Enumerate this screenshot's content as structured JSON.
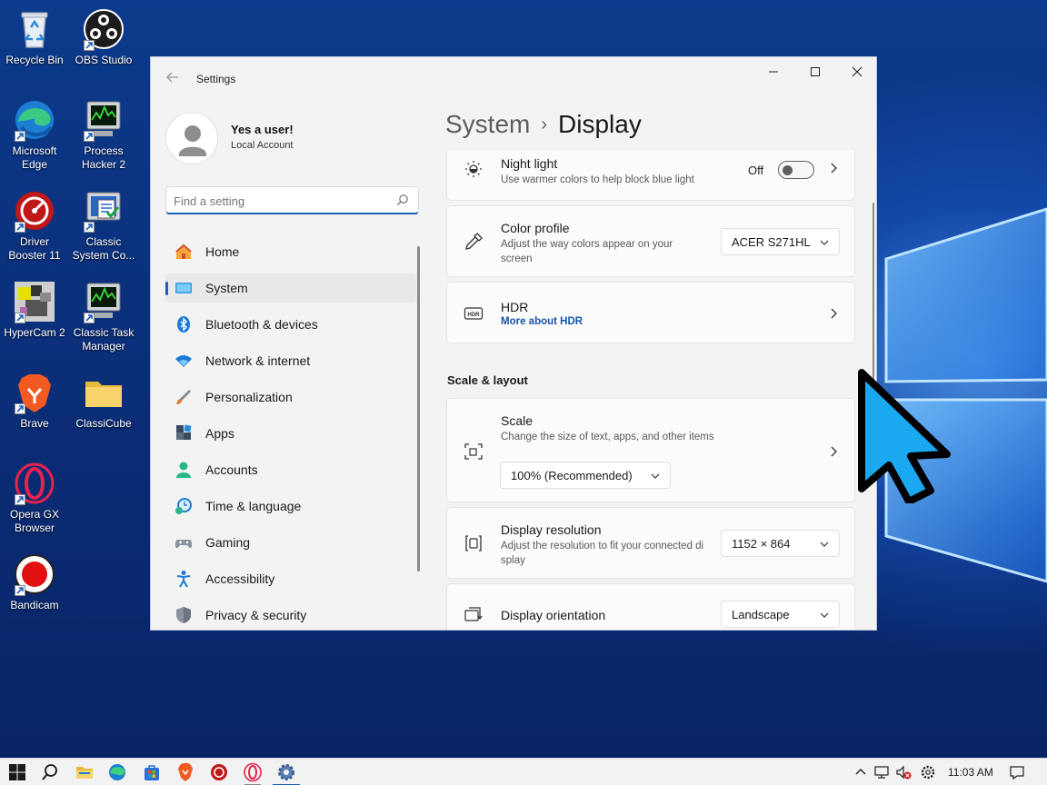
{
  "desktop": {
    "icons": [
      {
        "label": "Recycle Bin"
      },
      {
        "label": "OBS Studio"
      },
      {
        "label": "Microsoft Edge"
      },
      {
        "label": "Process Hacker 2"
      },
      {
        "label": "Driver Booster 11"
      },
      {
        "label": "Classic System Co..."
      },
      {
        "label": "HyperCam 2"
      },
      {
        "label": "Classic Task Manager"
      },
      {
        "label": "Brave"
      },
      {
        "label": "ClassiCube"
      },
      {
        "label": "Opera GX Browser"
      },
      {
        "label": "Bandicam"
      }
    ]
  },
  "window": {
    "title": "Settings",
    "back_icon": "back-arrow-icon",
    "controls": [
      "minimize-icon",
      "maximize-icon",
      "close-icon"
    ]
  },
  "profile": {
    "name": "Yes a user!",
    "account_type": "Local Account"
  },
  "search": {
    "placeholder": "Find a setting",
    "value": ""
  },
  "sidebar": {
    "items": [
      {
        "label": "Home",
        "icon": "home-icon"
      },
      {
        "label": "System",
        "icon": "system-icon",
        "selected": true
      },
      {
        "label": "Bluetooth & devices",
        "icon": "bluetooth-icon"
      },
      {
        "label": "Network & internet",
        "icon": "wifi-icon"
      },
      {
        "label": "Personalization",
        "icon": "brush-icon"
      },
      {
        "label": "Apps",
        "icon": "apps-icon"
      },
      {
        "label": "Accounts",
        "icon": "accounts-icon"
      },
      {
        "label": "Time & language",
        "icon": "clock-globe-icon"
      },
      {
        "label": "Gaming",
        "icon": "gamepad-icon"
      },
      {
        "label": "Accessibility",
        "icon": "accessibility-icon"
      },
      {
        "label": "Privacy & security",
        "icon": "shield-icon"
      }
    ]
  },
  "page": {
    "breadcrumb_parent": "System",
    "breadcrumb_separator": "›",
    "title": "Display"
  },
  "cards": {
    "night_light": {
      "title": "Night light",
      "description": "Use warmer colors to help block blue light",
      "toggle_state": "Off"
    },
    "color_profile": {
      "title": "Color profile",
      "description": "Adjust the way colors appear on your screen",
      "selected": "ACER S271HL"
    },
    "hdr": {
      "title": "HDR",
      "link": "More about HDR"
    },
    "scale": {
      "title": "Scale",
      "description": "Change the size of text, apps, and other items",
      "selected": "100% (Recommended)"
    },
    "resolution": {
      "title": "Display resolution",
      "description": "Adjust the resolution to fit your connected display",
      "selected": "1152 × 864"
    },
    "orientation": {
      "title": "Display orientation",
      "selected": "Landscape"
    }
  },
  "sections": {
    "scale_layout": "Scale & layout"
  },
  "taskbar": {
    "apps": [
      "windows-start-icon",
      "search-icon",
      "file-explorer-icon",
      "edge-icon",
      "microsoft-store-icon",
      "brave-icon",
      "driver-booster-icon",
      "opera-gx-icon",
      "settings-gear-icon"
    ],
    "clock": "11:03 AM"
  },
  "colors": {
    "accent": "#1c5fb8",
    "window_bg": "#f3f3f3",
    "card_bg": "#fbfbfb",
    "link": "#1755a8",
    "taskbar_bg": "#f2f2f2",
    "cursor_fill": "#1aa8f0"
  }
}
